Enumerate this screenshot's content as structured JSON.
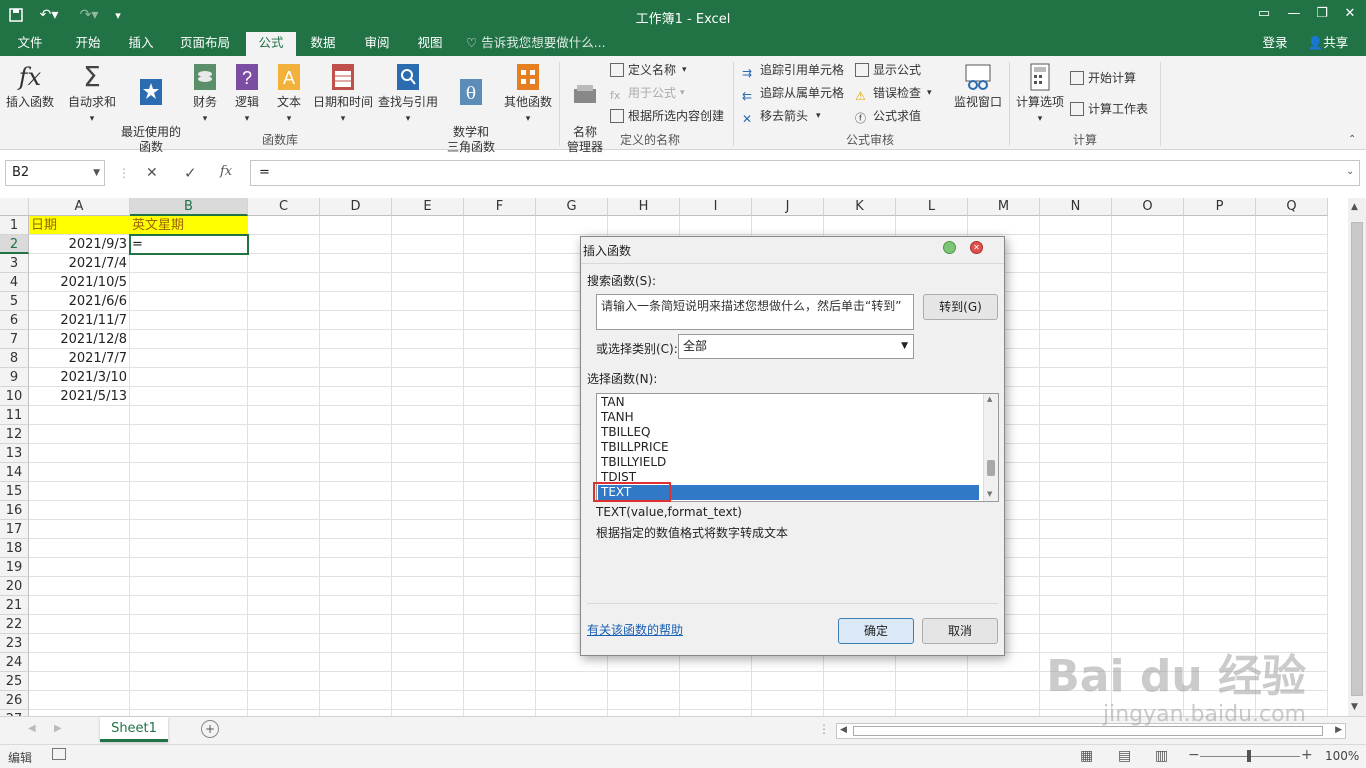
{
  "window": {
    "title": "工作簿1 - Excel"
  },
  "tabs": [
    "文件",
    "开始",
    "插入",
    "页面布局",
    "公式",
    "数据",
    "审阅",
    "视图"
  ],
  "tell_me": "告诉我您想要做什么...",
  "account": {
    "login": "登录",
    "share": "共享"
  },
  "ribbon": {
    "library": {
      "insert_fn": "插入函数",
      "autosum": "自动求和",
      "recent": "最近使用的\n函数",
      "financial": "财务",
      "logical": "逻辑",
      "text": "文本",
      "datetime": "日期和时间",
      "lookup": "查找与引用",
      "math": "数学和\n三角函数",
      "more": "其他函数",
      "group": "函数库"
    },
    "names": {
      "manager": "名称\n管理器",
      "define": "定义名称",
      "use": "用于公式",
      "create": "根据所选内容创建",
      "group": "定义的名称"
    },
    "audit": {
      "trace_prec": "追踪引用单元格",
      "trace_dep": "追踪从属单元格",
      "remove": "移去箭头",
      "show": "显示公式",
      "error": "错误检查",
      "eval": "公式求值",
      "watch": "监视窗口",
      "group": "公式审核"
    },
    "calc": {
      "options": "计算选项",
      "calc_now": "开始计算",
      "calc_sheet": "计算工作表",
      "group": "计算"
    }
  },
  "formula_bar": {
    "name_box": "B2",
    "content": "=",
    "fx": "fx"
  },
  "columns": [
    "A",
    "B",
    "C",
    "D",
    "E",
    "F",
    "G",
    "H",
    "I",
    "J",
    "K",
    "L",
    "M",
    "N",
    "O",
    "P",
    "Q"
  ],
  "rows": [
    "1",
    "2",
    "3",
    "4",
    "5",
    "6",
    "7",
    "8",
    "9",
    "10",
    "11",
    "12",
    "13",
    "14",
    "15",
    "16",
    "17",
    "18",
    "19",
    "20",
    "21",
    "22",
    "23",
    "24",
    "25",
    "26",
    "27"
  ],
  "cells": {
    "A1": "日期",
    "B1": "英文星期",
    "B2": "=",
    "dates": [
      "2021/9/3",
      "2021/7/4",
      "2021/10/5",
      "2021/6/6",
      "2021/11/7",
      "2021/12/8",
      "2021/7/7",
      "2021/3/10",
      "2021/5/13"
    ]
  },
  "sheet": {
    "tab": "Sheet1"
  },
  "status": {
    "mode": "编辑",
    "zoom": "100%"
  },
  "dialog": {
    "title": "插入函数",
    "search_label": "搜索函数(S):",
    "search_text": "请输入一条简短说明来描述您想做什么，然后单击“转到”",
    "go_button": "转到(G)",
    "category_label": "或选择类别(C):",
    "category_value": "全部",
    "select_label": "选择函数(N):",
    "functions": [
      "TAN",
      "TANH",
      "TBILLEQ",
      "TBILLPRICE",
      "TBILLYIELD",
      "TDIST",
      "TEXT"
    ],
    "selected": "TEXT",
    "signature": "TEXT(value,format_text)",
    "description": "根据指定的数值格式将数字转成文本",
    "help_link": "有关该函数的帮助",
    "ok": "确定",
    "cancel": "取消"
  },
  "watermark": {
    "brand": "Bai du 经验",
    "url": "jingyan.baidu.com"
  },
  "colors": {
    "excel_green": "#217346",
    "highlight_yellow": "#ffff00",
    "selection_blue": "#3179c6",
    "annotation_red": "#e03030"
  }
}
